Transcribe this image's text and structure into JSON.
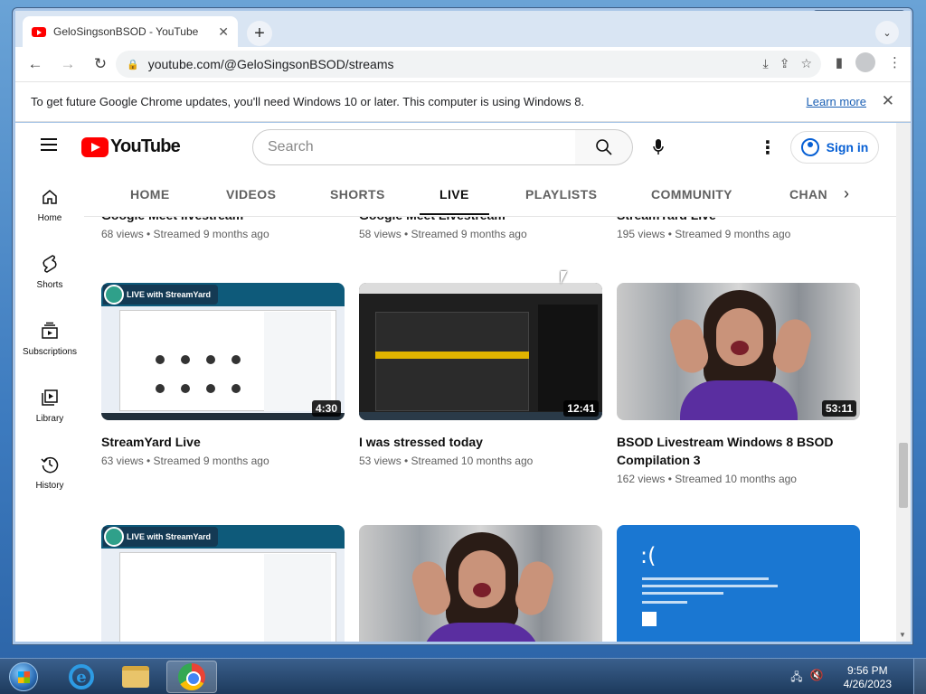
{
  "browser": {
    "tab_title": "GeloSingsonBSOD - YouTube",
    "url": "youtube.com/@GeloSingsonBSOD/streams",
    "infobar_text": "To get future Google Chrome updates, you'll need Windows 10 or later. This computer is using Windows 8.",
    "infobar_link": "Learn more"
  },
  "youtube": {
    "logo_text": "YouTube",
    "search_placeholder": "Search",
    "signin_label": "Sign in",
    "nav": [
      {
        "label": "Home",
        "icon": "home-icon"
      },
      {
        "label": "Shorts",
        "icon": "shorts-icon"
      },
      {
        "label": "Subscriptions",
        "icon": "subscriptions-icon"
      },
      {
        "label": "Library",
        "icon": "library-icon"
      },
      {
        "label": "History",
        "icon": "history-icon"
      }
    ],
    "tabs": [
      "HOME",
      "VIDEOS",
      "SHORTS",
      "LIVE",
      "PLAYLISTS",
      "COMMUNITY",
      "CHAN"
    ],
    "active_tab": "LIVE",
    "top_row": [
      {
        "title": "Google Meet livestream",
        "meta": "68 views • Streamed 9 months ago"
      },
      {
        "title": "Google Meet Livestream",
        "meta": "58 views • Streamed 9 months ago"
      },
      {
        "title": "StreamYard Live",
        "meta": "195 views • Streamed 9 months ago"
      }
    ],
    "videos": [
      {
        "title": "StreamYard Live",
        "meta": "63 views • Streamed 9 months ago",
        "duration": "4:30",
        "badge": "LIVE with StreamYard"
      },
      {
        "title": "I was stressed today",
        "meta": "53 views • Streamed 10 months ago",
        "duration": "12:41"
      },
      {
        "title": "BSOD Livestream Windows 8 BSOD Compilation 3",
        "meta": "162 views • Streamed 10 months ago",
        "duration": "53:11"
      }
    ],
    "bottom_row": [
      {
        "badge": "LIVE with StreamYard"
      },
      {},
      {
        "bsod_face": ":("
      }
    ]
  },
  "taskbar": {
    "time": "9:56 PM",
    "date": "4/26/2023"
  }
}
